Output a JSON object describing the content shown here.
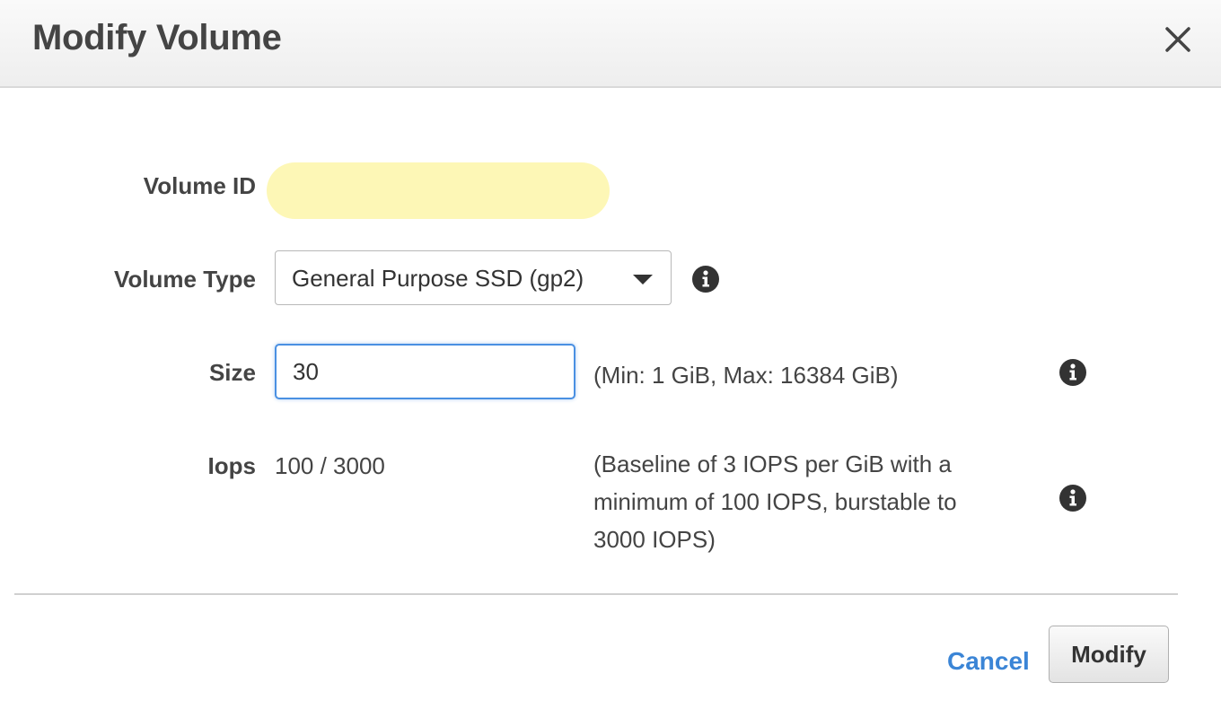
{
  "dialog": {
    "title": "Modify Volume",
    "close_icon": "close-icon"
  },
  "form": {
    "volume_id": {
      "label": "Volume ID",
      "value": ""
    },
    "volume_type": {
      "label": "Volume Type",
      "selected": "General Purpose SSD (gp2)",
      "info_icon": "info-icon"
    },
    "size": {
      "label": "Size",
      "value": "30",
      "hint": "(Min: 1 GiB, Max: 16384 GiB)",
      "info_icon": "info-icon"
    },
    "iops": {
      "label": "Iops",
      "value": "100 / 3000",
      "hint_lines": [
        "(Baseline of 3 IOPS per GiB with a",
        "minimum of 100 IOPS, burstable to",
        "3000 IOPS)"
      ],
      "info_icon": "info-icon"
    }
  },
  "footer": {
    "cancel_label": "Cancel",
    "modify_label": "Modify"
  },
  "colors": {
    "link": "#3b85d6",
    "focus_border": "#4a90e2",
    "id_highlight": "#fdf7b6"
  }
}
